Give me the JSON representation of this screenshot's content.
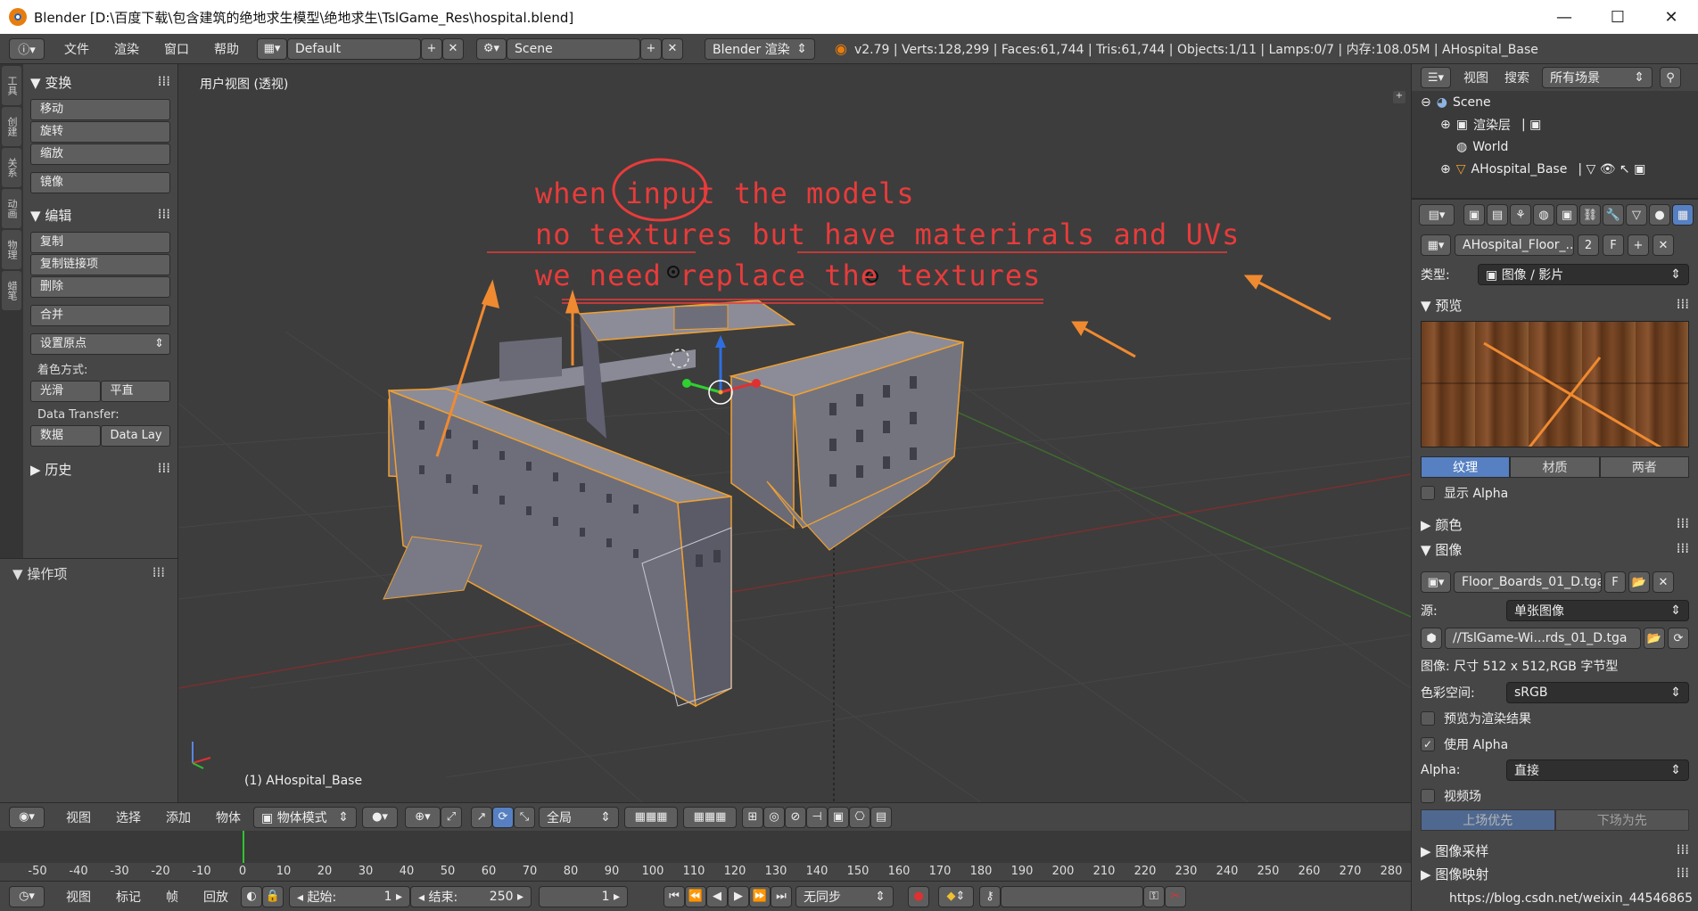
{
  "window": {
    "title": "Blender [D:\\百度下载\\包含建筑的绝地求生模型\\绝地求生\\TslGame_Res\\hospital.blend]"
  },
  "info_header": {
    "menus": [
      "文件",
      "渲染",
      "窗口",
      "帮助"
    ],
    "layout": "Default",
    "scene": "Scene",
    "engine": "Blender 渲染",
    "stats": "v2.79 | Verts:128,299 | Faces:61,744 | Tris:61,744 | Objects:1/11 | Lamps:0/7 | 内存:108.05M | AHospital_Base"
  },
  "tool_tabs": [
    "工具",
    "创建",
    "关系",
    "动画",
    "物理",
    "蜡笔"
  ],
  "tool_shelf": {
    "transform_header": "变换",
    "transform_buttons": [
      "移动",
      "旋转",
      "缩放"
    ],
    "mirror": "镜像",
    "edit_header": "编辑",
    "edit_buttons": [
      "复制",
      "复制链接项",
      "删除"
    ],
    "join": "合并",
    "set_origin": "设置原点",
    "shading_label": "着色方式:",
    "shade_smooth": "光滑",
    "shade_flat": "平直",
    "data_transfer_label": "Data Transfer:",
    "data": "数据",
    "data_layout": "Data Lay",
    "history_header": "历史",
    "operator_header": "操作项"
  },
  "viewport": {
    "view_label": "用户视图 (透视)",
    "object_label": "(1) AHospital_Base",
    "annotation_lines": [
      "when input the models",
      "no textures but have materirals and UVs",
      "we need replace the textures"
    ]
  },
  "viewport_header": {
    "menus": [
      "视图",
      "选择",
      "添加",
      "物体"
    ],
    "mode": "物体模式",
    "orientation": "全局"
  },
  "timeline": {
    "ticks": [
      "-50",
      "-40",
      "-30",
      "-20",
      "-10",
      "0",
      "10",
      "20",
      "30",
      "40",
      "50",
      "60",
      "70",
      "80",
      "90",
      "100",
      "110",
      "120",
      "130",
      "140",
      "150",
      "160",
      "170",
      "180",
      "190",
      "200",
      "210",
      "220",
      "230",
      "240",
      "250",
      "260",
      "270",
      "280"
    ],
    "menus": [
      "视图",
      "标记",
      "帧",
      "回放"
    ],
    "start_label": "起始:",
    "start_value": "1",
    "end_label": "结束:",
    "end_value": "250",
    "current_frame": "1",
    "sync": "无同步"
  },
  "outliner": {
    "menus": [
      "视图",
      "搜索"
    ],
    "filter": "所有场景",
    "items": [
      "Scene",
      "渲染层",
      "World",
      "AHospital_Base"
    ]
  },
  "properties": {
    "texture_name": "AHospital_Floor_...",
    "users": "2",
    "fake_user": "F",
    "type_label": "类型:",
    "type_value": "图像 / 影片",
    "preview_header": "预览",
    "preview_tabs": [
      "纹理",
      "材质",
      "两者"
    ],
    "show_alpha": "显示 Alpha",
    "color_header": "颜色",
    "image_header": "图像",
    "image_name": "Floor_Boards_01_D.tga",
    "source_label": "源:",
    "source_value": "单张图像",
    "filepath": "//TslGame-Wi...rds_01_D.tga",
    "image_info": "图像: 尺寸 512 x 512,RGB 字节型",
    "colorspace_label": "色彩空间:",
    "colorspace_value": "sRGB",
    "view_as_render": "预览为渲染结果",
    "use_alpha": "使用 Alpha",
    "alpha_label": "Alpha:",
    "alpha_value": "直接",
    "fields": "视频场",
    "field_order": [
      "上场优先",
      "下场为先"
    ],
    "sampling_header": "图像采样",
    "mapping_header": "图像映射"
  },
  "watermark": "https://blog.csdn.net/weixin_44546865",
  "colors": {
    "accent_blue": "#5680c2",
    "selection_orange": "#f0a030",
    "annotation_red": "#e83b3b",
    "arrow_orange": "#f08a30"
  }
}
